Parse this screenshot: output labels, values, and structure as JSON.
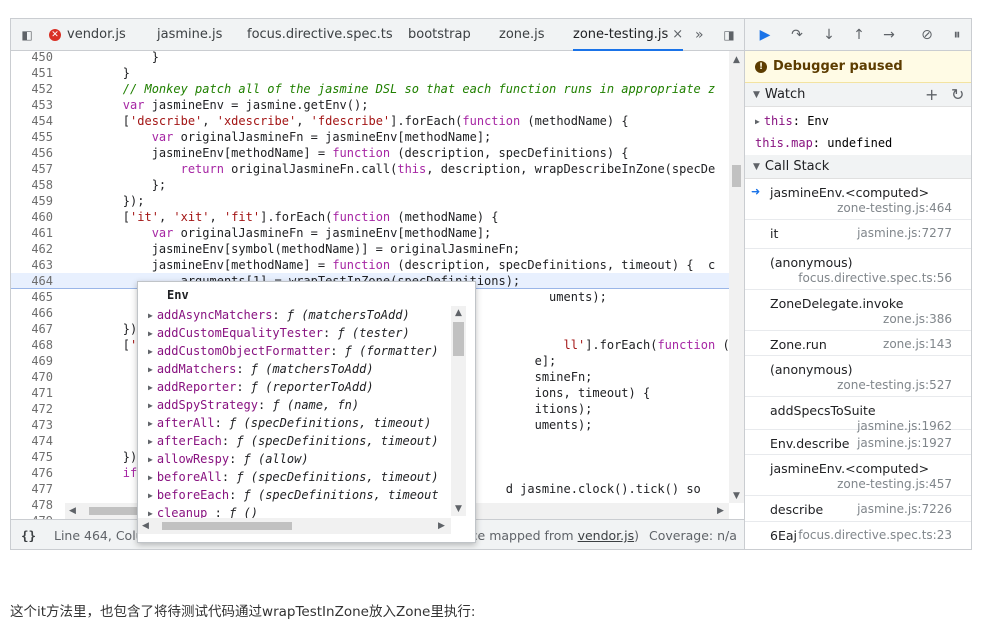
{
  "tabs": [
    {
      "label": "vendor.js",
      "has_error": true,
      "active": false
    },
    {
      "label": "jasmine.js",
      "has_error": false,
      "active": false
    },
    {
      "label": "focus.directive.spec.ts",
      "has_error": false,
      "active": false
    },
    {
      "label": "bootstrap",
      "has_error": false,
      "active": false
    },
    {
      "label": "zone.js",
      "has_error": false,
      "active": false
    },
    {
      "label": "zone-testing.js",
      "has_error": false,
      "active": true
    }
  ],
  "tab_overflow": "»",
  "tab_close": "×",
  "editor": {
    "paused_line": "464",
    "lines": [
      {
        "n": "450",
        "code": "            }"
      },
      {
        "n": "451",
        "code": "        }"
      },
      {
        "n": "452",
        "code": "        // Monkey patch all of the jasmine DSL so that each function runs in appropriate z"
      },
      {
        "n": "453",
        "code": "        var jasmineEnv = jasmine.getEnv();"
      },
      {
        "n": "454",
        "code": "        ['describe', 'xdescribe', 'fdescribe'].forEach(function (methodName) {"
      },
      {
        "n": "455",
        "code": "            var originalJasmineFn = jasmineEnv[methodName];"
      },
      {
        "n": "456",
        "code": "            jasmineEnv[methodName] = function (description, specDefinitions) {"
      },
      {
        "n": "457",
        "code": "                return originalJasmineFn.call(this, description, wrapDescribeInZone(specDe"
      },
      {
        "n": "458",
        "code": "            };"
      },
      {
        "n": "459",
        "code": "        });"
      },
      {
        "n": "460",
        "code": "        ['it', 'xit', 'fit'].forEach(function (methodName) {"
      },
      {
        "n": "461",
        "code": "            var originalJasmineFn = jasmineEnv[methodName];"
      },
      {
        "n": "462",
        "code": "            jasmineEnv[symbol(methodName)] = originalJasmineFn;"
      },
      {
        "n": "463",
        "code": "            jasmineEnv[methodName] = function (description, specDefinitions, timeout) {  c"
      },
      {
        "n": "464",
        "code": "                arguments[1] = wrapTestInZone(specDefinitions);"
      },
      {
        "n": "465",
        "code": "                                                                   uments);"
      },
      {
        "n": "466",
        "code": ""
      },
      {
        "n": "467",
        "code": "        });"
      },
      {
        "n": "468",
        "code": "        ['b                                                          ll'].forEach(function (methodName)"
      },
      {
        "n": "469",
        "code": "                                                                 e];"
      },
      {
        "n": "470",
        "code": "                                                                 smineFn;"
      },
      {
        "n": "471",
        "code": "                                                                 ions, timeout) {"
      },
      {
        "n": "472",
        "code": "                                                                 itions);"
      },
      {
        "n": "473",
        "code": "                                                                 uments);"
      },
      {
        "n": "474",
        "code": ""
      },
      {
        "n": "475",
        "code": "        });"
      },
      {
        "n": "476",
        "code": "        if"
      },
      {
        "n": "477",
        "code": "                                                             d jasmine.clock().tick() so"
      },
      {
        "n": "478",
        "code": ""
      },
      {
        "n": "479",
        "code": ""
      }
    ]
  },
  "autocomplete": {
    "header": "Env",
    "items": [
      {
        "name": "addAsyncMatchers",
        "sig": "ƒ (matchersToAdd)"
      },
      {
        "name": "addCustomEqualityTester",
        "sig": "ƒ (tester)"
      },
      {
        "name": "addCustomObjectFormatter",
        "sig": "ƒ (formatter)"
      },
      {
        "name": "addMatchers",
        "sig": "ƒ (matchersToAdd)"
      },
      {
        "name": "addReporter",
        "sig": "ƒ (reporterToAdd)"
      },
      {
        "name": "addSpyStrategy",
        "sig": "ƒ (name, fn)"
      },
      {
        "name": "afterAll",
        "sig": "ƒ (specDefinitions, timeout)"
      },
      {
        "name": "afterEach",
        "sig": "ƒ (specDefinitions, timeout)"
      },
      {
        "name": "allowRespy",
        "sig": "ƒ (allow)"
      },
      {
        "name": "beforeAll",
        "sig": "ƒ (specDefinitions, timeout)"
      },
      {
        "name": "beforeEach",
        "sig": "ƒ (specDefinitions, timeout"
      },
      {
        "name": "cleanup_",
        "sig": "ƒ ()"
      }
    ]
  },
  "status": {
    "braces": "{}",
    "position": "Line 464, Colu",
    "source_prefix": "urce mapped from ",
    "source_link": "vendor.js",
    "source_suffix": ")",
    "coverage": "Coverage: n/a"
  },
  "debugger": {
    "paused_label": "Debugger paused",
    "watch_title": "Watch",
    "watch_add": "+",
    "watch_refresh": "↻",
    "watch_items": [
      {
        "expr": "this",
        "value": "Env",
        "expandable": true
      },
      {
        "expr": "this.map",
        "value": "undefined",
        "expandable": false
      }
    ],
    "callstack_title": "Call Stack",
    "frames": [
      {
        "name": "jasmineEnv.<computed>",
        "location": "zone-testing.js:464",
        "current": true
      },
      {
        "name": "it",
        "location": "jasmine.js:7277",
        "current": false
      },
      {
        "name": "(anonymous)",
        "location": "focus.directive.spec.ts:56",
        "current": false
      },
      {
        "name": "ZoneDelegate.invoke",
        "location": "zone.js:386",
        "current": false
      },
      {
        "name": "Zone.run",
        "location": "zone.js:143",
        "current": false
      },
      {
        "name": "(anonymous)",
        "location": "zone-testing.js:527",
        "current": false
      },
      {
        "name": "addSpecsToSuite",
        "location": "jasmine.js:1962",
        "current": false
      },
      {
        "name": "Env.describe",
        "location": "jasmine.js:1927",
        "current": false
      },
      {
        "name": "jasmineEnv.<computed>",
        "location": "zone-testing.js:457",
        "current": false
      },
      {
        "name": "describe",
        "location": "jasmine.js:7226",
        "current": false
      },
      {
        "name": "6Eaj",
        "location": "focus.directive.spec.ts:23",
        "current": false
      }
    ]
  },
  "caption": "这个it方法里，也包含了将待测试代码通过wrapTestInZone放入Zone里执行:"
}
